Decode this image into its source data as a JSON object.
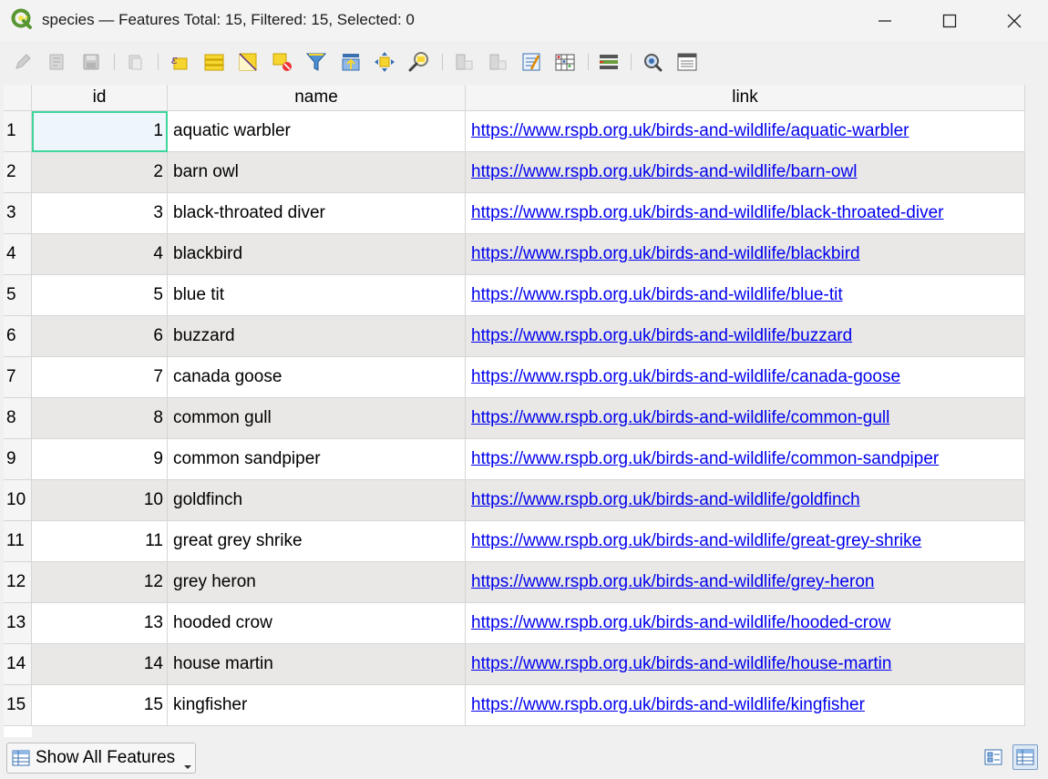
{
  "window": {
    "title": "species — Features Total: 15, Filtered: 15, Selected: 0"
  },
  "toolbar": {
    "icons": [
      "edit-pencil-icon",
      "multi-edit-icon",
      "save-icon",
      "delete-icon",
      "select-expression-icon",
      "select-all-icon",
      "invert-selection-icon",
      "deselect-icon",
      "filter-icon",
      "move-selection-top-icon",
      "pan-to-selection-icon",
      "zoom-to-selection-icon",
      "new-field-icon",
      "delete-field-icon",
      "field-calculator-icon",
      "conditional-formatting-icon",
      "actions-icon",
      "dock-icon",
      "organize-columns-icon"
    ]
  },
  "table": {
    "columns": [
      "id",
      "name",
      "link"
    ],
    "rows": [
      {
        "num": "1",
        "id": "1",
        "name": "aquatic warbler",
        "link": "https://www.rspb.org.uk/birds-and-wildlife/aquatic-warbler"
      },
      {
        "num": "2",
        "id": "2",
        "name": "barn owl",
        "link": "https://www.rspb.org.uk/birds-and-wildlife/barn-owl"
      },
      {
        "num": "3",
        "id": "3",
        "name": "black-throated diver",
        "link": "https://www.rspb.org.uk/birds-and-wildlife/black-throated-diver"
      },
      {
        "num": "4",
        "id": "4",
        "name": "blackbird",
        "link": "https://www.rspb.org.uk/birds-and-wildlife/blackbird"
      },
      {
        "num": "5",
        "id": "5",
        "name": "blue tit",
        "link": "https://www.rspb.org.uk/birds-and-wildlife/blue-tit"
      },
      {
        "num": "6",
        "id": "6",
        "name": "buzzard",
        "link": "https://www.rspb.org.uk/birds-and-wildlife/buzzard"
      },
      {
        "num": "7",
        "id": "7",
        "name": "canada goose",
        "link": "https://www.rspb.org.uk/birds-and-wildlife/canada-goose"
      },
      {
        "num": "8",
        "id": "8",
        "name": "common gull",
        "link": "https://www.rspb.org.uk/birds-and-wildlife/common-gull"
      },
      {
        "num": "9",
        "id": "9",
        "name": "common sandpiper",
        "link": "https://www.rspb.org.uk/birds-and-wildlife/common-sandpiper"
      },
      {
        "num": "10",
        "id": "10",
        "name": "goldfinch",
        "link": "https://www.rspb.org.uk/birds-and-wildlife/goldfinch"
      },
      {
        "num": "11",
        "id": "11",
        "name": "great grey shrike",
        "link": "https://www.rspb.org.uk/birds-and-wildlife/great-grey-shrike"
      },
      {
        "num": "12",
        "id": "12",
        "name": "grey heron",
        "link": "https://www.rspb.org.uk/birds-and-wildlife/grey-heron"
      },
      {
        "num": "13",
        "id": "13",
        "name": "hooded crow",
        "link": "https://www.rspb.org.uk/birds-and-wildlife/hooded-crow"
      },
      {
        "num": "14",
        "id": "14",
        "name": "house martin",
        "link": "https://www.rspb.org.uk/birds-and-wildlife/house-martin"
      },
      {
        "num": "15",
        "id": "15",
        "name": "kingfisher",
        "link": "https://www.rspb.org.uk/birds-and-wildlife/kingfisher"
      }
    ]
  },
  "footer": {
    "filter_label": "Show All Features"
  },
  "colors": {
    "link": "#0000ee",
    "row_alt": "#e9e8e6",
    "current_cell_border": "#3fd69c"
  }
}
